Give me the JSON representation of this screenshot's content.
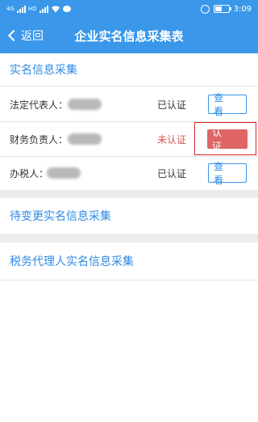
{
  "status_bar": {
    "net_tag_1": "4G",
    "net_tag_2": "HD",
    "time": "3:09"
  },
  "nav": {
    "back_label": "返回",
    "title": "企业实名信息采集表"
  },
  "section_realname": {
    "title": "实名信息采集",
    "rows": [
      {
        "label": "法定代表人：",
        "status": "已认证",
        "status_type": "ok",
        "button": "查 看"
      },
      {
        "label": "财务负责人：",
        "status": "未认证",
        "status_type": "pending",
        "button": "认 证"
      },
      {
        "label": "办税人：",
        "status": "已认证",
        "status_type": "ok",
        "button": "查 看"
      }
    ]
  },
  "section_pending": {
    "title": "待变更实名信息采集"
  },
  "section_agent": {
    "title": "税务代理人实名信息采集"
  },
  "colors": {
    "primary": "#3a97e9",
    "link": "#2e8be4",
    "danger": "#e06666",
    "highlight": "#d72525"
  }
}
